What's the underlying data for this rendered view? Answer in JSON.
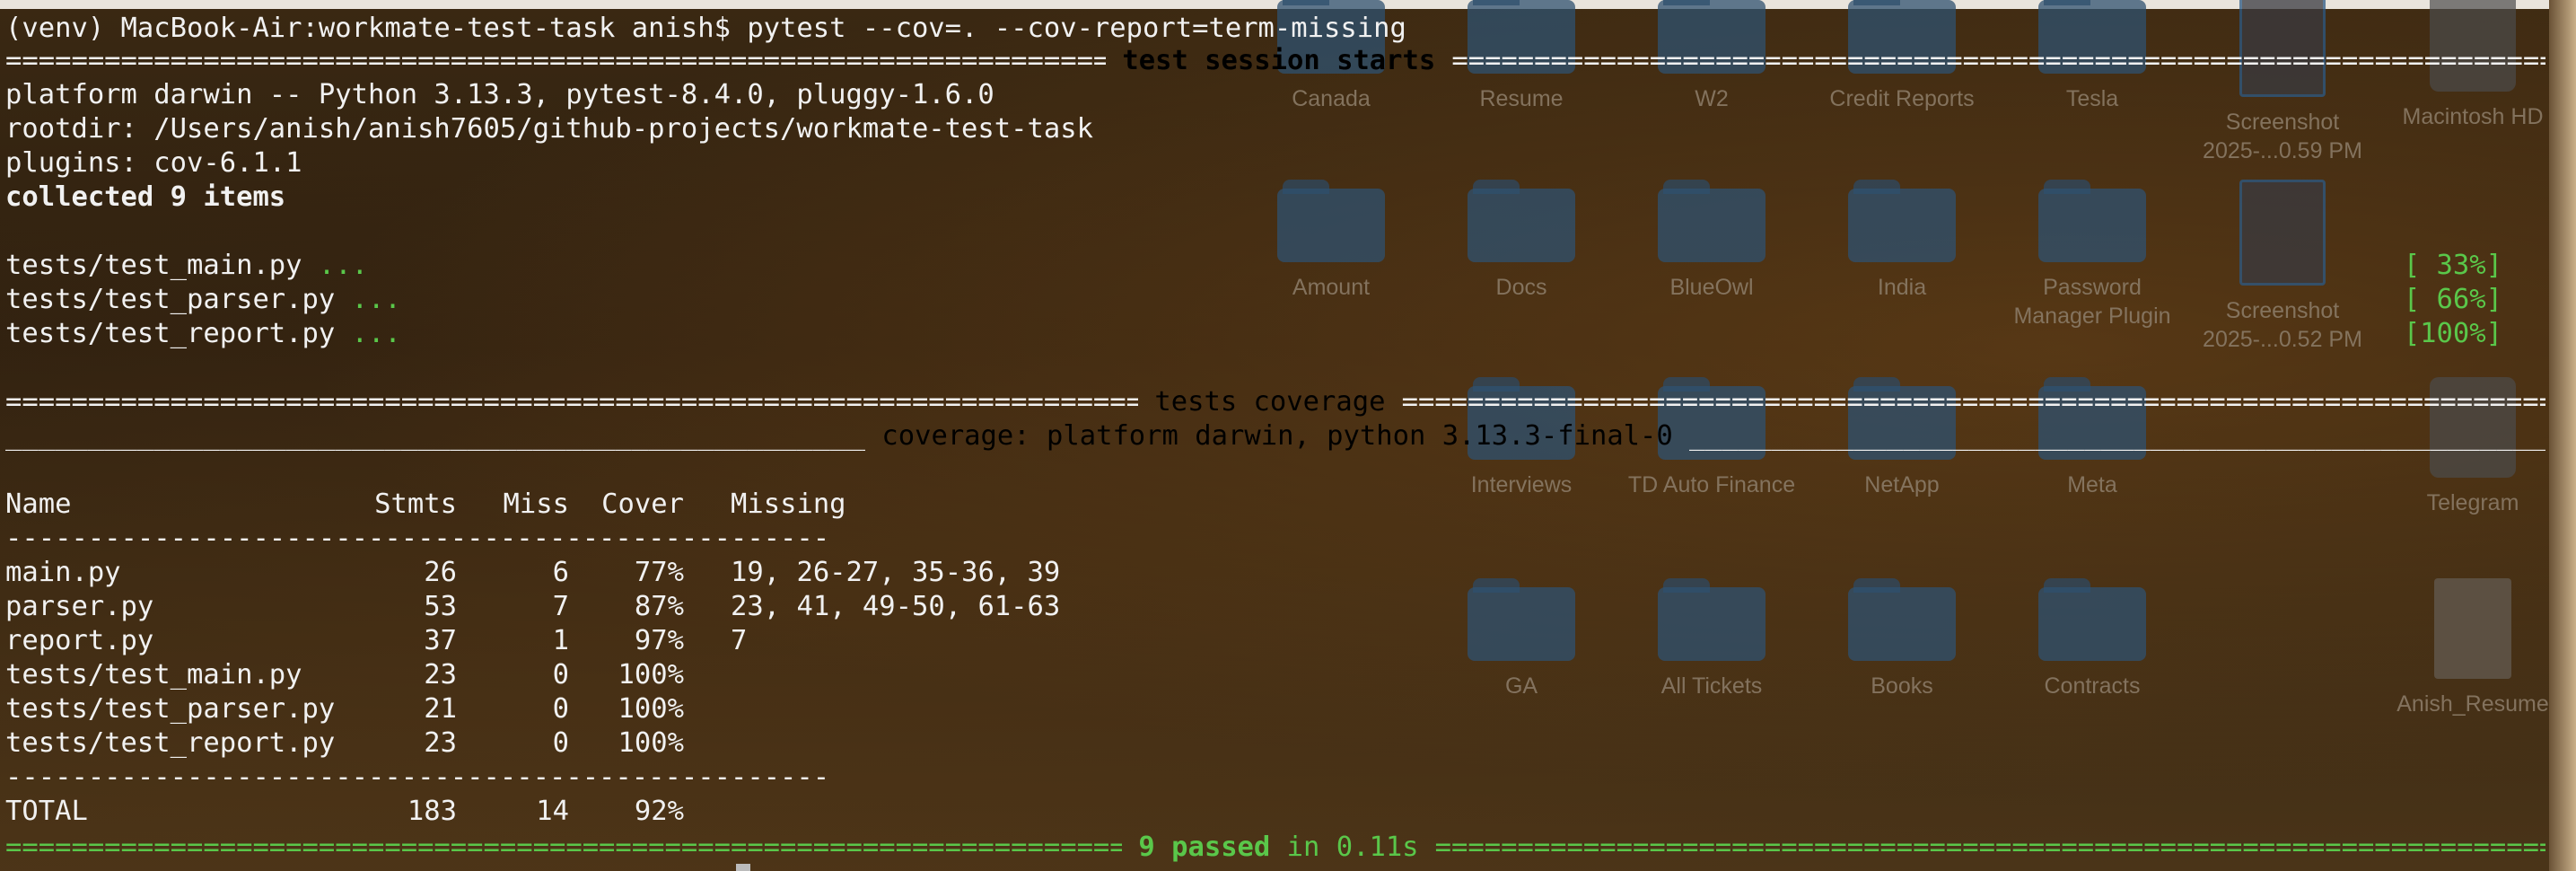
{
  "prompt": "(venv) MacBook-Air:workmate-test-task anish$ pytest --cov=. --cov-report=term-missing",
  "session_header": " test session starts ",
  "platform_line": "platform darwin -- Python 3.13.3, pytest-8.4.0, pluggy-1.6.0",
  "rootdir_line": "rootdir: /Users/anish/anish7605/github-projects/workmate-test-task",
  "plugins_line": "plugins: cov-6.1.1",
  "collected_line": "collected 9 items",
  "test_files": [
    {
      "name": "tests/test_main.py ",
      "dots": "...",
      "progress": "[ 33%]"
    },
    {
      "name": "tests/test_parser.py ",
      "dots": "...",
      "progress": "[ 66%]"
    },
    {
      "name": "tests/test_report.py ",
      "dots": "...",
      "progress": "[100%]"
    }
  ],
  "coverage_header": " tests coverage ",
  "coverage_subheader": " coverage: platform darwin, python 3.13.3-final-0 ",
  "table": {
    "headers": {
      "name": "Name",
      "stmts": "Stmts",
      "miss": "Miss",
      "cover": "Cover",
      "missing": "Missing"
    },
    "divider": "--------------------------------------------------",
    "rows": [
      {
        "name": "main.py",
        "stmts": "26",
        "miss": "6",
        "cover": "77%",
        "missing": "19, 26-27, 35-36, 39"
      },
      {
        "name": "parser.py",
        "stmts": "53",
        "miss": "7",
        "cover": "87%",
        "missing": "23, 41, 49-50, 61-63"
      },
      {
        "name": "report.py",
        "stmts": "37",
        "miss": "1",
        "cover": "97%",
        "missing": "7"
      },
      {
        "name": "tests/test_main.py",
        "stmts": "23",
        "miss": "0",
        "cover": "100%",
        "missing": ""
      },
      {
        "name": "tests/test_parser.py",
        "stmts": "21",
        "miss": "0",
        "cover": "100%",
        "missing": ""
      },
      {
        "name": "tests/test_report.py",
        "stmts": "23",
        "miss": "0",
        "cover": "100%",
        "missing": ""
      }
    ],
    "total": {
      "name": "TOTAL",
      "stmts": "183",
      "miss": "14",
      "cover": "92%"
    }
  },
  "summary": {
    "passed": "9 passed",
    "in": " in 0.11s "
  },
  "desktop_icons": [
    {
      "label": "Canada",
      "kind": "folder"
    },
    {
      "label": "Resume",
      "kind": "folder"
    },
    {
      "label": "W2",
      "kind": "folder"
    },
    {
      "label": "Credit Reports",
      "kind": "folder"
    },
    {
      "label": "Tesla",
      "kind": "folder"
    },
    {
      "label": "Screenshot\n2025-...0.59 PM",
      "kind": "doc"
    },
    {
      "label": "Macintosh HD",
      "kind": "drive"
    },
    {
      "label": "Amount",
      "kind": "folder"
    },
    {
      "label": "Docs",
      "kind": "folder"
    },
    {
      "label": "BlueOwl",
      "kind": "folder"
    },
    {
      "label": "India",
      "kind": "folder"
    },
    {
      "label": "Password\nManager Plugin",
      "kind": "folder"
    },
    {
      "label": "Screenshot\n2025-...0.52 PM",
      "kind": "doc"
    },
    {
      "label": "Interviews",
      "kind": "folder"
    },
    {
      "label": "TD Auto Finance",
      "kind": "folder"
    },
    {
      "label": "NetApp",
      "kind": "folder"
    },
    {
      "label": "Meta",
      "kind": "folder"
    },
    {
      "label": "Telegram",
      "kind": "drive"
    },
    {
      "label": "GA",
      "kind": "folder"
    },
    {
      "label": "All Tickets",
      "kind": "folder"
    },
    {
      "label": "Books",
      "kind": "folder"
    },
    {
      "label": "Contracts",
      "kind": "folder"
    },
    {
      "label": "Anish_Resume",
      "kind": "pdf"
    }
  ],
  "colors": {
    "green": "#5ac74a",
    "text": "#f1f1f1"
  }
}
